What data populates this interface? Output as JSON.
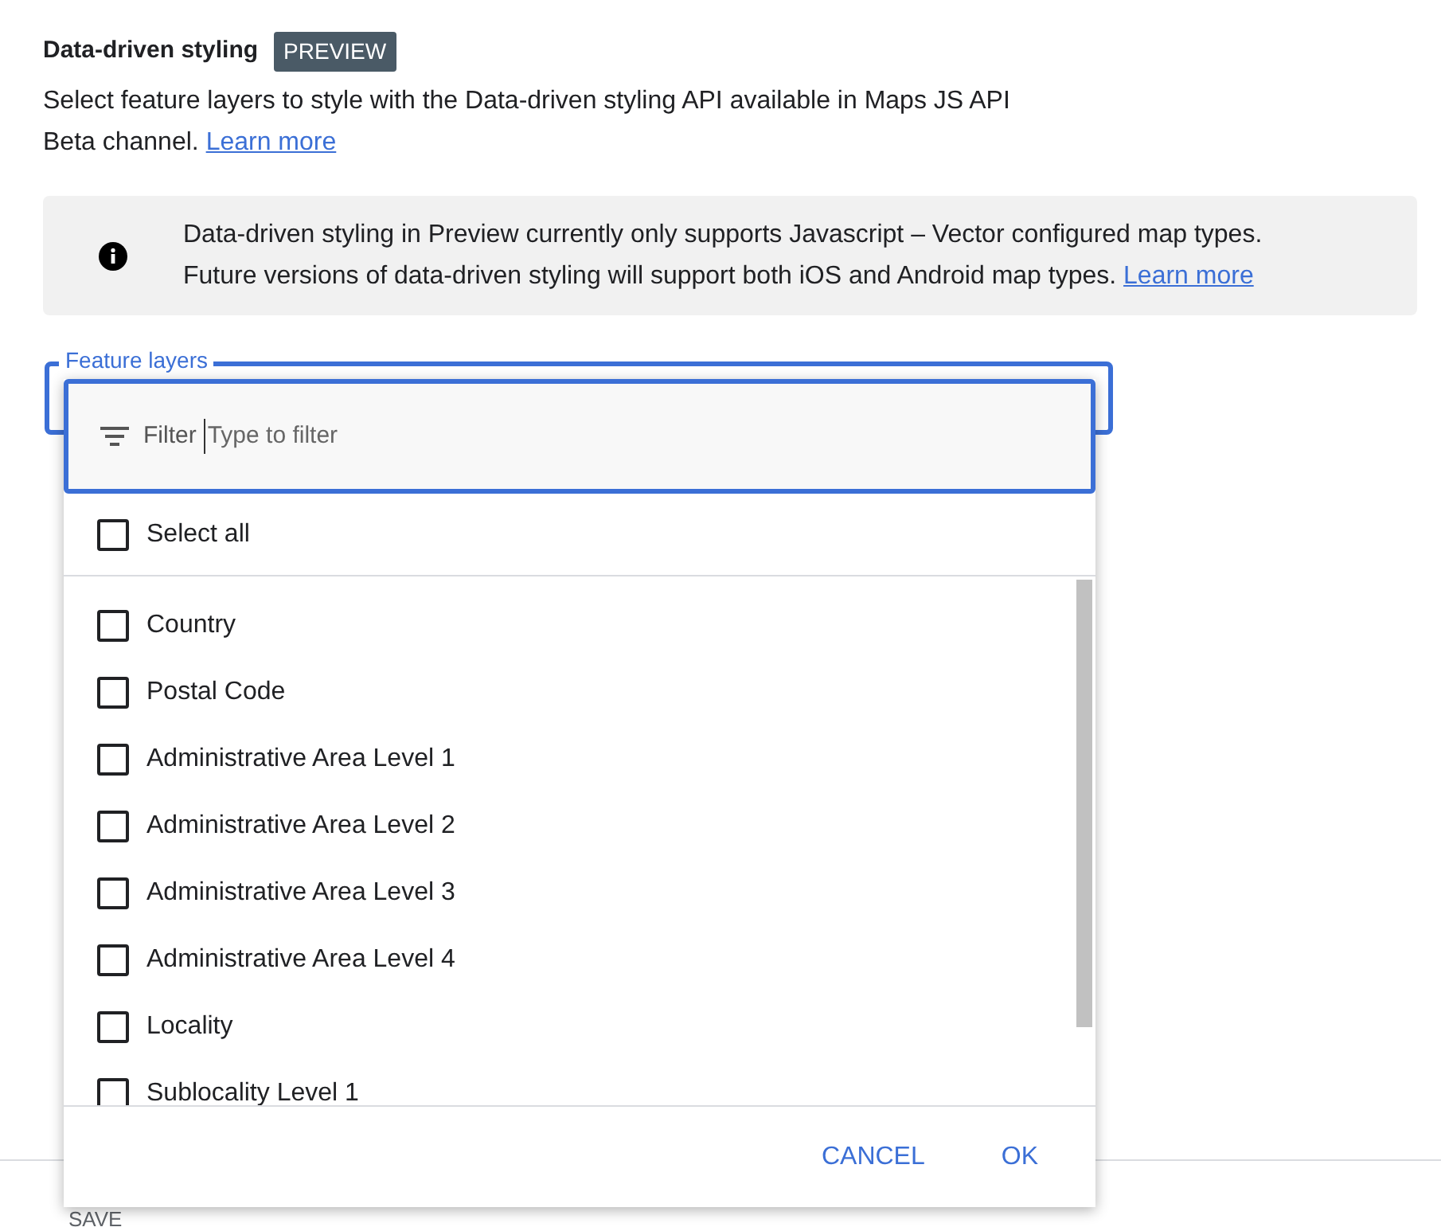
{
  "section": {
    "title": "Data-driven styling",
    "badge": "PREVIEW",
    "description": "Select feature layers to style with the Data-driven styling API available in Maps JS API Beta channel.",
    "link": "Learn more"
  },
  "notice": {
    "text": "Data-driven styling in Preview currently only supports Javascript – Vector configured map types. Future versions of data-driven styling will support both iOS and Android map types.",
    "link": "Learn more"
  },
  "feature_layers": {
    "label": "Feature layers",
    "filter": {
      "label": "Filter",
      "placeholder": "Type to filter"
    },
    "select_all": {
      "label": "Select all",
      "checked": false
    },
    "items": [
      {
        "label": "Country",
        "checked": false
      },
      {
        "label": "Postal Code",
        "checked": false
      },
      {
        "label": "Administrative Area Level 1",
        "checked": false
      },
      {
        "label": "Administrative Area Level 2",
        "checked": false
      },
      {
        "label": "Administrative Area Level 3",
        "checked": false
      },
      {
        "label": "Administrative Area Level 4",
        "checked": false
      },
      {
        "label": "Locality",
        "checked": false
      },
      {
        "label": "Sublocality Level 1",
        "checked": false
      }
    ],
    "buttons": [
      "CANCEL",
      "OK"
    ]
  },
  "save_button": "SAVE"
}
